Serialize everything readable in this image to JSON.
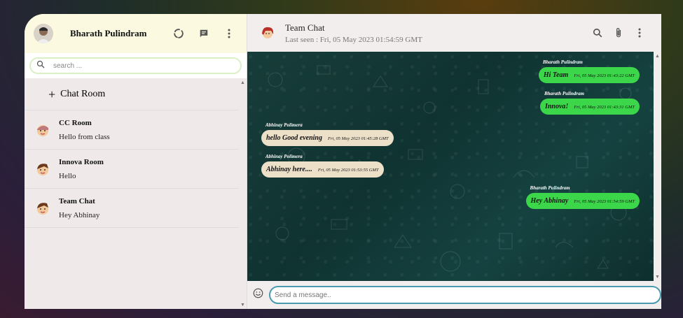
{
  "sidebar": {
    "user_name": "Bharath Pulindram",
    "search_placeholder": "search ...",
    "add_room_label": "Chat Room",
    "rooms": [
      {
        "name": "CC Room",
        "last_message": "Hello from class"
      },
      {
        "name": "Innova Room",
        "last_message": "Hello"
      },
      {
        "name": "Team Chat",
        "last_message": "Hey Abhinay"
      }
    ]
  },
  "header": {
    "room_name": "Team Chat",
    "last_seen": "Last seen : Fri, 05 May 2023 01:54:59 GMT"
  },
  "messages": [
    {
      "sender": "Bharath Pulindram",
      "text": "Hi Team",
      "time": "Fri, 05 May 2023 01:43:22 GMT",
      "direction": "out"
    },
    {
      "sender": "Bharath Pulindram",
      "text": "Innova!",
      "time": "Fri, 05 May 2023 01:43:31 GMT",
      "direction": "out"
    },
    {
      "sender": "Abhinay Polimera",
      "text": "hello Good evening",
      "time": "Fri, 05 May 2023 01:45:28 GMT",
      "direction": "in"
    },
    {
      "sender": "Abhinay Polimera",
      "text": "Abhinay here....",
      "time": "Fri, 05 May 2023 01:53:55 GMT",
      "direction": "in"
    },
    {
      "sender": "Bharath Pulindram",
      "text": "Hey Abhinay",
      "time": "Fri, 05 May 2023 01:54:59 GMT",
      "direction": "out"
    }
  ],
  "composer": {
    "placeholder": "Send a message.."
  },
  "colors": {
    "outgoing_bubble": "#3cd64a",
    "incoming_bubble": "#ede0c8",
    "sidebar_header": "#fbfae0",
    "chat_background": "#0f3331"
  },
  "icons": [
    "status-icon",
    "chat-icon",
    "more-vert-icon",
    "search-icon",
    "attach-icon",
    "emoji-icon"
  ]
}
